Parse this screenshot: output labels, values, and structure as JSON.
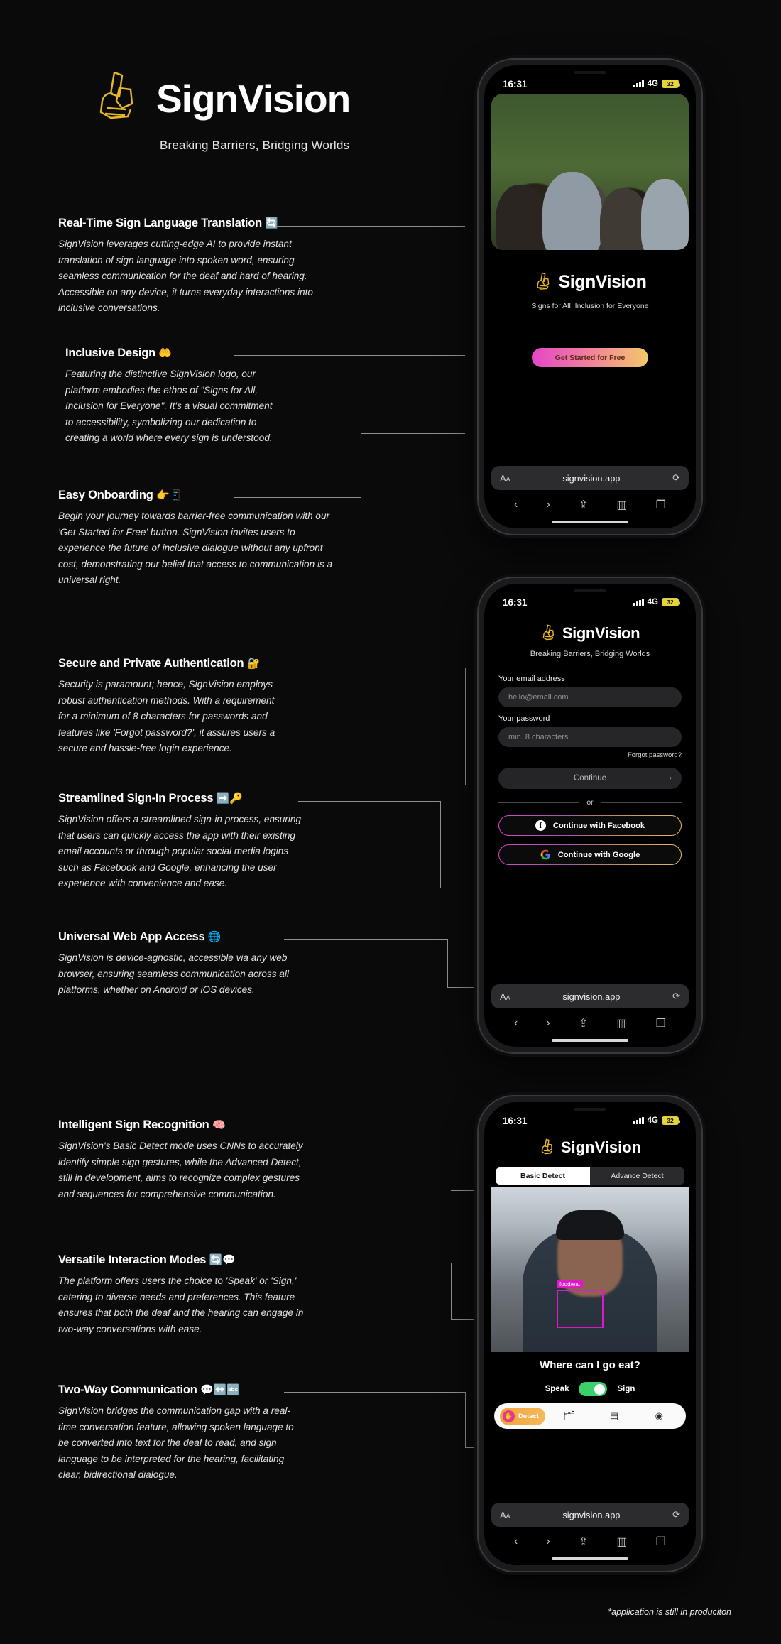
{
  "brand": {
    "name": "SignVision",
    "tagline": "Breaking Barriers, Bridging Worlds",
    "logo_icon": "hand-sign-logo-icon"
  },
  "features": [
    {
      "heading": "Real-Time Sign Language Translation",
      "emoji": "🔄",
      "body": "SignVision leverages cutting-edge AI to provide instant translation of sign language into spoken word, ensuring seamless communication for the deaf and hard of hearing. Accessible on any device, it turns everyday interactions into inclusive conversations."
    },
    {
      "heading": "Inclusive Design",
      "emoji": "🤲",
      "body": "Featuring the distinctive SignVision logo, our platform embodies the ethos of \"Signs for All, Inclusion for Everyone\". It's a visual commitment to accessibility, symbolizing our dedication to creating a world where every sign is understood."
    },
    {
      "heading": "Easy Onboarding",
      "emoji": "👉📱",
      "body": "Begin your journey towards barrier-free communication with our 'Get Started for Free' button. SignVision invites users to experience the future of inclusive dialogue without any upfront cost, demonstrating our belief that access to communication is a universal right."
    },
    {
      "heading": "Secure and Private Authentication",
      "emoji": "🔐",
      "body": "Security is paramount; hence, SignVision employs robust authentication methods. With a requirement for a minimum of 8 characters for passwords and features like 'Forgot password?', it assures users a secure and hassle-free login experience."
    },
    {
      "heading": "Streamlined Sign-In Process",
      "emoji": "➡️🔑",
      "body": "SignVision offers a streamlined sign-in process, ensuring that users can quickly access the app with their existing email accounts or through popular social media logins such as Facebook and Google, enhancing the user experience with convenience and ease."
    },
    {
      "heading": "Universal Web App Access",
      "emoji": "🌐",
      "body": "SignVision is device-agnostic, accessible via any web browser, ensuring seamless communication across all platforms, whether on Android or iOS devices."
    },
    {
      "heading": "Intelligent Sign Recognition",
      "emoji": "🧠",
      "body": "SignVision's Basic Detect mode uses CNNs to accurately identify simple sign gestures, while the Advanced Detect, still in development, aims to recognize complex gestures and sequences for comprehensive communication."
    },
    {
      "heading": "Versatile Interaction Modes",
      "emoji": "🔄💬",
      "body": "The platform offers users the choice to 'Speak' or 'Sign,' catering to diverse needs and preferences. This feature ensures that both the deaf and the hearing can engage in two-way conversations with ease."
    },
    {
      "heading": "Two-Way Communication",
      "emoji": "💬↔️🔤",
      "body": "SignVision bridges the communication gap with a real-time conversation feature, allowing spoken language to be converted into text for the deaf to read, and sign language to be interpreted for the hearing, facilitating clear, bidirectional dialogue."
    }
  ],
  "statusbar": {
    "time": "16:31",
    "network": "4G",
    "battery": "32"
  },
  "safari": {
    "aa_label": "AA",
    "host": "signvision.app",
    "reload_icon": "reload-icon",
    "back_icon": "‹",
    "forward_icon": "›",
    "share_icon": "share-icon",
    "bookmarks_icon": "book-icon",
    "tabs_icon": "tabs-icon"
  },
  "phone1": {
    "app_name": "SignVision",
    "subtitle": "Signs for All, Inclusion for Everyone",
    "cta": "Get Started for Free"
  },
  "phone2": {
    "app_name": "SignVision",
    "subtitle": "Breaking Barriers, Bridging Worlds",
    "email_label": "Your email address",
    "email_placeholder": "hello@email.com",
    "password_label": "Your password",
    "password_placeholder": "min. 8 characters",
    "forgot": "Forgot password?",
    "continue": "Continue",
    "or": "or",
    "facebook": "Continue with Facebook",
    "google": "Continue with Google"
  },
  "phone3": {
    "app_name": "SignVision",
    "mode_basic": "Basic Detect",
    "mode_advance": "Advance Detect",
    "detection_label": "food/eat",
    "question": "Where can I go eat?",
    "speak_label": "Speak",
    "sign_label": "Sign",
    "tab_detect": "Detect",
    "tab_icons": [
      "folder-icon",
      "card-icon",
      "record-icon"
    ]
  },
  "footnote": "*application is still in produciton",
  "colors": {
    "accent_pink": "#e546c8",
    "accent_gold": "#e0bd6a",
    "logo_gold": "#e8b827",
    "battery_yellow": "#e8d43a"
  }
}
